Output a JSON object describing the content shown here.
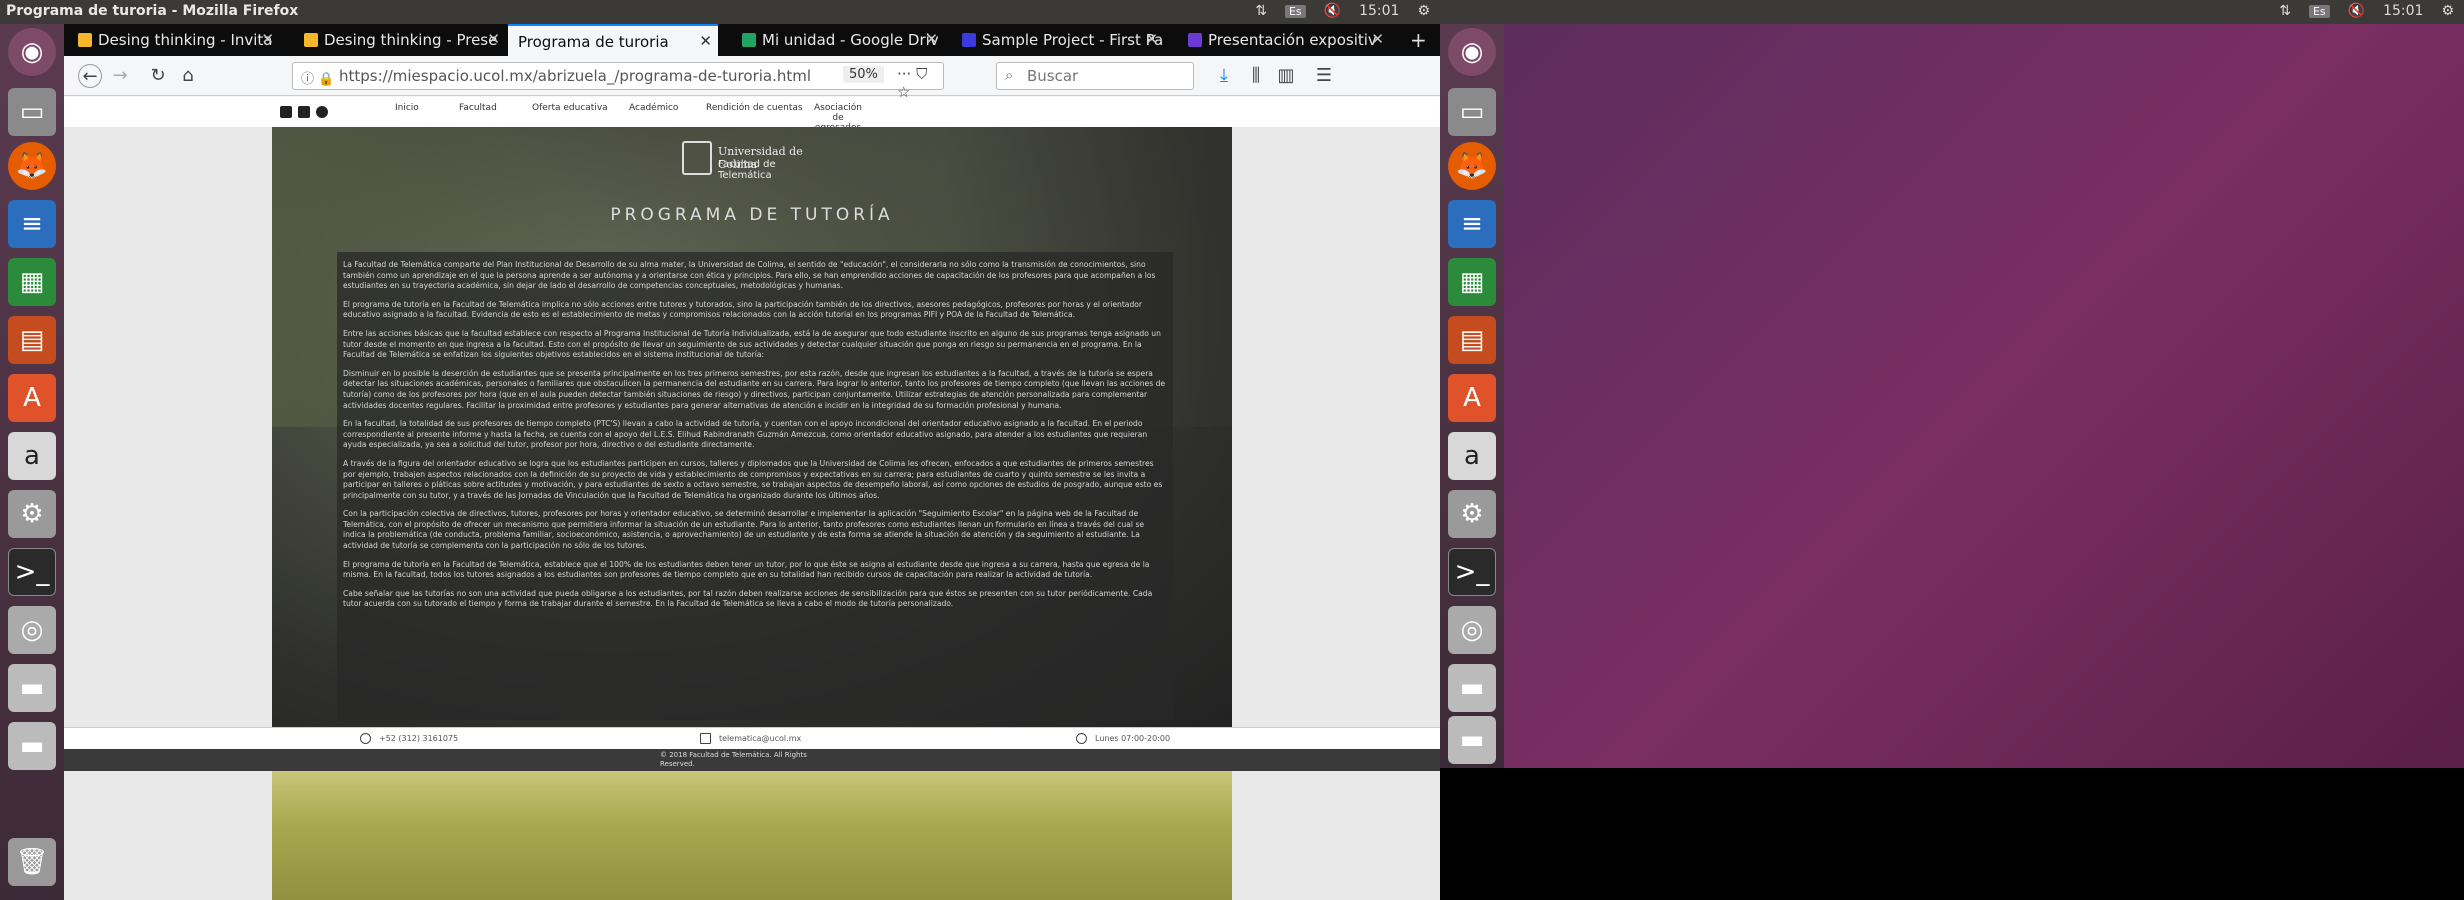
{
  "window_title": "Programa de turoria - Mozilla Firefox",
  "clock": "15:01",
  "keyboard": "Es",
  "tabs": [
    {
      "label": "Desing thinking - Invita",
      "color": "#f6b72b"
    },
    {
      "label": "Desing thinking - Prese",
      "color": "#f6b72b"
    },
    {
      "label": "Programa de turoria",
      "color": ""
    },
    {
      "label": "Mi unidad - Google Driv",
      "color": "#1fa463"
    },
    {
      "label": "Sample Project - First Pa",
      "color": "#3a3adf"
    },
    {
      "label": "Presentación expositiv",
      "color": "#6d3ad6"
    }
  ],
  "url": "https://miespacio.ucol.mx/abrizuela_/programa-de-turoria.html",
  "zoom": "50%",
  "search_placeholder": "Buscar",
  "site": {
    "menu": [
      "Inicio",
      "Facultad",
      "Oferta educativa",
      "Académico",
      "Rendición de cuentas",
      "Asociación de egresados"
    ],
    "logo_line1": "Universidad de Colima",
    "logo_line2": "Facultad de Telemática",
    "page_title": "PROGRAMA DE TUTORÍA",
    "paragraphs": [
      "La Facultad de Telemática comparte del Plan Institucional de Desarrollo de su alma mater, la Universidad de Colima, el sentido de \"educación\", el considerarla no sólo como la transmisión de conocimientos, sino también como un aprendizaje en el que la persona aprende a ser autónoma y a orientarse con ética y principios. Para ello, se han emprendido acciones de capacitación de los profesores para que acompañen a los estudiantes en su trayectoria académica, sin dejar de lado el desarrollo de competencias conceptuales, metodológicas y humanas.",
      "El programa de tutoría en la Facultad de Telemática implica no sólo acciones entre tutores y tutorados, sino la participación también de los directivos, asesores pedagógicos, profesores por horas y el orientador educativo asignado a la facultad. Evidencia de esto es el establecimiento de metas y compromisos relacionados con la acción tutorial en los programas PIFI y POA de la Facultad de Telemática.",
      "Entre las acciones básicas que la facultad establece con respecto al Programa Institucional de Tutoría Individualizada, está la de asegurar que todo estudiante inscrito en alguno de sus programas tenga asignado un tutor desde el momento en que ingresa a la facultad. Esto con el propósito de llevar un seguimiento de sus actividades y detectar cualquier situación que ponga en riesgo su permanencia en el programa. En la Facultad de Telemática se enfatizan los siguientes objetivos establecidos en el sistema institucional de tutoría:",
      "Disminuir en lo posible la deserción de estudiantes que se presenta principalmente en los tres primeros semestres, por esta razón, desde que ingresan los estudiantes a la facultad, a través de la tutoría se espera detectar las situaciones académicas, personales o familiares que obstaculicen la permanencia del estudiante en su carrera. Para lograr lo anterior, tanto los profesores de tiempo completo (que llevan las acciones de tutoría) como de los profesores por hora (que en el aula pueden detectar también situaciones de riesgo) y directivos, participan conjuntamente. Utilizar estrategias de atención personalizada para complementar actividades docentes regulares. Facilitar la proximidad entre profesores y estudiantes para generar alternativas de atención e incidir en la integridad de su formación profesional y humana.",
      "En la facultad, la totalidad de sus profesores de tiempo completo (PTC'S) llevan a cabo la actividad de tutoría, y cuentan con el apoyo incondicional del orientador educativo asignado a la facultad. En el periodo correspondiente al presente informe y hasta la fecha, se cuenta con el apoyo del L.E.S. Elihud Rabindranath Guzmán Amezcua, como orientador educativo asignado, para atender a los estudiantes que requieran ayuda especializada, ya sea a solicitud del tutor, profesor por hora, directivo o del estudiante directamente.",
      "A través de la figura del orientador educativo se logra que los estudiantes participen en cursos, talleres y diplomados que la Universidad de Colima les ofrecen, enfocados a que estudiantes de primeros semestres por ejemplo, trabajen aspectos relacionados con la definición de su proyecto de vida y establecimiento de compromisos y expectativas en su carrera; para estudiantes de cuarto y quinto semestre se les invita a participar en talleres o pláticas sobre actitudes y motivación, y para estudiantes de sexto a octavo semestre, se trabajan aspectos de desempeño laboral, así como opciones de estudios de posgrado, aunque esto es principalmente con su tutor, y a través de las Jornadas de Vinculación que la Facultad de Telemática ha organizado durante los últimos años.",
      "Con la participación colectiva de directivos, tutores, profesores por horas y orientador educativo, se determinó desarrollar e implementar la aplicación \"Seguimiento Escolar\" en la página web de la Facultad de Telemática, con el propósito de ofrecer un mecanismo que permitiera informar la situación de un estudiante. Para lo anterior, tanto profesores como estudiantes llenan un formulario en línea a través del cual se indica la problemática (de conducta, problema familiar, socioeconómico, asistencia, o aprovechamiento) de un estudiante y de esta forma se atiende la situación de atención y da seguimiento al estudiante. La actividad de tutoría se complementa con la participación no sólo de los tutores.",
      "El programa de tutoría en la Facultad de Telemática, establece que el 100% de los estudiantes deben tener un tutor, por lo que éste se asigna al estudiante desde que ingresa a su carrera, hasta que egresa de la misma. En la facultad, todos los tutores asignados a los estudiantes son profesores de tiempo completo que en su totalidad han recibido cursos de capacitación para realizar la actividad de tutoría.",
      "Cabe señalar que las tutorías no son una actividad que pueda obligarse a los estudiantes, por tal razón deben realizarse acciones de sensibilización para que éstos se presenten con su tutor periódicamente. Cada tutor acuerda con su tutorado el tiempo y forma de trabajar durante el semestre. En la Facultad de Telemática se lleva a cabo el modo de tutoría personalizado."
    ],
    "contact_phone": "+52 (312) 3161075",
    "contact_email": "telematica@ucol.mx",
    "contact_hours": "Lunes 07:00-20:00",
    "footer": "© 2018 Facultad de Telemática. All Rights Reserved."
  }
}
